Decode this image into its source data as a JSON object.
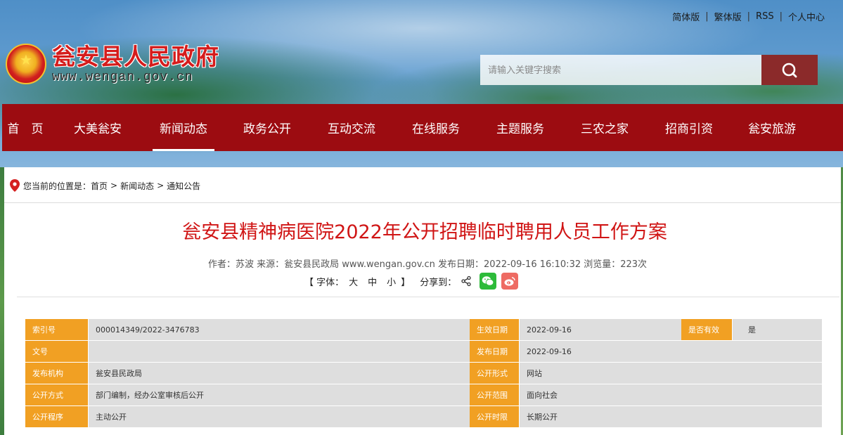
{
  "top_links": [
    "简体版",
    "繁体版",
    "RSS",
    "个人中心"
  ],
  "site": {
    "title": "瓮安县人民政府",
    "url": "www.wengan.gov.cn"
  },
  "search": {
    "placeholder": "请输入关键字搜索"
  },
  "nav": [
    "首　页",
    "大美瓮安",
    "新闻动态",
    "政务公开",
    "互动交流",
    "在线服务",
    "主题服务",
    "三农之家",
    "招商引资",
    "瓮安旅游"
  ],
  "nav_active": "新闻动态",
  "breadcrumb": {
    "prefix": "您当前的位置是：",
    "items": [
      "首页",
      "新闻动态",
      "通知公告"
    ],
    "separator": ">"
  },
  "article": {
    "title": "瓮安县精神病医院2022年公开招聘临时聘用人员工作方案",
    "meta": "作者：苏波 来源：瓮安县民政局 www.wengan.gov.cn 发布日期：2022-09-16 16:10:32 浏览量：223次"
  },
  "tools": {
    "font_label": "【 字体：",
    "sizes": [
      "大",
      "中",
      "小"
    ],
    "font_close": "】",
    "share_label": "分享到：",
    "share_icons": [
      "share-icon",
      "wechat-icon",
      "weibo-icon"
    ]
  },
  "info_table": {
    "rows": [
      [
        {
          "k": "索引号",
          "v": "000014349/2022-3476783"
        },
        {
          "k": "生效日期",
          "v": "2022-09-16"
        },
        {
          "k": "是否有效",
          "v": "是"
        }
      ],
      [
        {
          "k": "文号",
          "v": ""
        },
        {
          "k": "发布日期",
          "v": "2022-09-16"
        }
      ],
      [
        {
          "k": "发布机构",
          "v": "瓮安县民政局"
        },
        {
          "k": "公开形式",
          "v": "网站"
        }
      ],
      [
        {
          "k": "公开方式",
          "v": "部门编制，经办公室审核后公开"
        },
        {
          "k": "公开范围",
          "v": "面向社会"
        }
      ],
      [
        {
          "k": "公开程序",
          "v": "主动公开"
        },
        {
          "k": "公开时限",
          "v": "长期公开"
        }
      ]
    ]
  },
  "colors": {
    "nav_bg": "#9c0c11",
    "title_red": "#d01515",
    "key_orange": "#f1a023",
    "value_gray": "#dedede",
    "search_button": "#8b2a2a"
  }
}
